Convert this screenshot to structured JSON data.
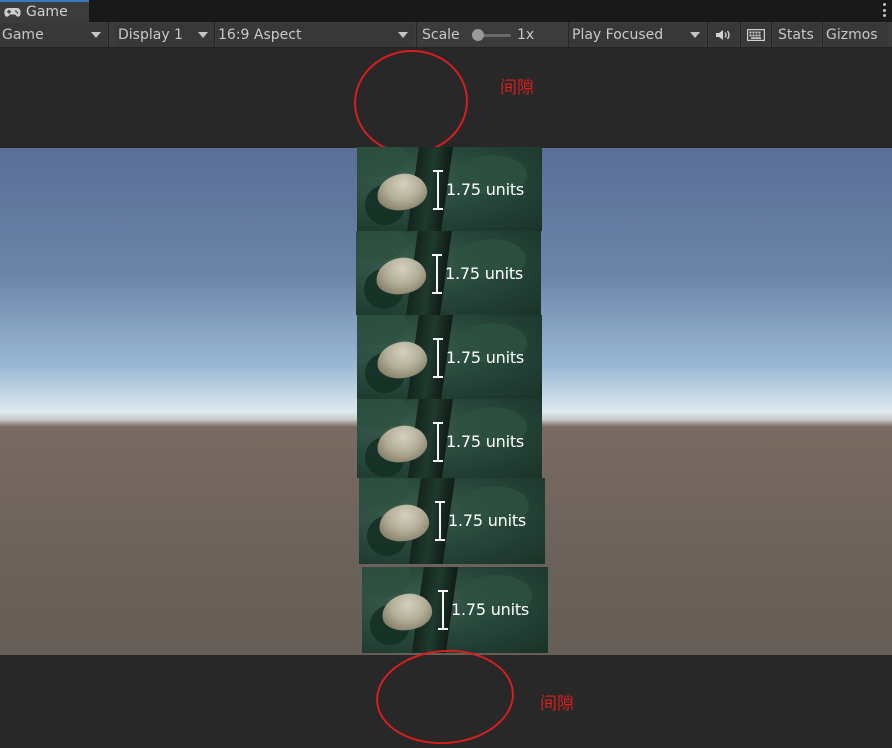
{
  "tab": {
    "title": "Game",
    "icon": "gamepad-icon"
  },
  "toolbar": {
    "mode": "Game",
    "display": "Display 1",
    "aspect": "16:9 Aspect",
    "scale_label": "Scale",
    "scale_value": "1x",
    "play_mode": "Play Focused",
    "audio_icon": "speaker-icon",
    "keyboard_icon": "keyboard-icon",
    "stats": "Stats",
    "gizmos": "Gizmos"
  },
  "tiles": [
    {
      "label": "1.75 units"
    },
    {
      "label": "1.75 units"
    },
    {
      "label": "1.75 units"
    },
    {
      "label": "1.75 units"
    },
    {
      "label": "1.75 units"
    },
    {
      "label": "1.75 units"
    }
  ],
  "annotations": {
    "top": "间隙",
    "bottom": "间隙",
    "color": "#d81e1e"
  }
}
